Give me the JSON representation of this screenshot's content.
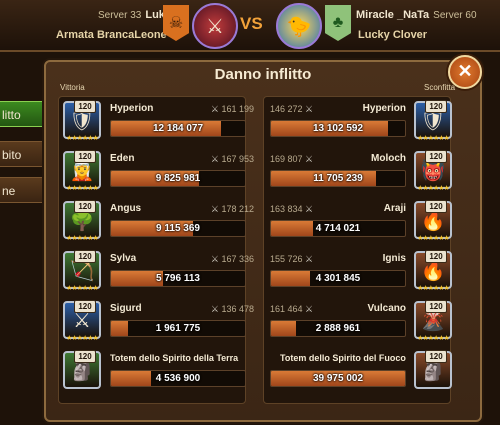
{
  "header": {
    "left": {
      "server": "Server 33",
      "name": "Luk",
      "guild": "Armata BrancaLeone",
      "banner_color": "#d9701f",
      "banner_emblem": "skull-icon"
    },
    "vs": "VS",
    "right": {
      "server": "Server 60",
      "name": "Miracle _NaTa",
      "guild": "Lucky Clover",
      "banner_color": "#8fc27a",
      "banner_emblem": "clover-icon"
    }
  },
  "side_tabs": [
    {
      "label": "Danno inflitto",
      "visible_text": "litto",
      "active": true
    },
    {
      "label": "",
      "visible_text": "bito",
      "active": false
    },
    {
      "label": "",
      "visible_text": "ne",
      "active": false
    }
  ],
  "panel": {
    "title": "Danno inflitto",
    "left_result": "Vittoria",
    "right_result": "Sconfitta"
  },
  "colors": {
    "accent": "#e07a2e",
    "bar_fill": "#c8652b",
    "active_tab": "#3c8a1f"
  },
  "left_heroes": [
    {
      "name": "Hyperion",
      "power": "161 199",
      "damage": "12 184 077",
      "level": "120",
      "stars": 6,
      "fill": 0.82,
      "icon": "hyperion-portrait",
      "frame": "#2c5fa8"
    },
    {
      "name": "Eden",
      "power": "167 953",
      "damage": "9 825 981",
      "level": "120",
      "stars": 6,
      "fill": 0.66,
      "icon": "eden-portrait",
      "frame": "#3f7a35"
    },
    {
      "name": "Angus",
      "power": "178 212",
      "damage": "9 115 369",
      "level": "120",
      "stars": 6,
      "fill": 0.61,
      "icon": "angus-portrait",
      "frame": "#3f7a35"
    },
    {
      "name": "Sylva",
      "power": "167 336",
      "damage": "5 796 113",
      "level": "120",
      "stars": 6,
      "fill": 0.39,
      "icon": "sylva-portrait",
      "frame": "#3f7a35"
    },
    {
      "name": "Sigurd",
      "power": "136 478",
      "damage": "1 961 775",
      "level": "120",
      "stars": 6,
      "fill": 0.13,
      "icon": "sigurd-portrait",
      "frame": "#2c5fa8"
    }
  ],
  "left_totem": {
    "name": "Totem dello Spirito della Terra",
    "damage": "4 536 900",
    "level": "120",
    "fill": 0.3,
    "icon": "earth-totem-portrait",
    "frame": "#3f7a35"
  },
  "right_heroes": [
    {
      "name": "Hyperion",
      "power": "146 272",
      "damage": "13 102 592",
      "level": "120",
      "stars": 6,
      "fill": 0.87,
      "icon": "hyperion-portrait",
      "frame": "#2c5fa8"
    },
    {
      "name": "Moloch",
      "power": "169 807",
      "damage": "11 705 239",
      "level": "120",
      "stars": 6,
      "fill": 0.78,
      "icon": "moloch-portrait",
      "frame": "#8a4b2a"
    },
    {
      "name": "Araji",
      "power": "163 834",
      "damage": "4 714 021",
      "level": "120",
      "stars": 6,
      "fill": 0.31,
      "icon": "araji-portrait",
      "frame": "#8a4b2a"
    },
    {
      "name": "Ignis",
      "power": "155 726",
      "damage": "4 301 845",
      "level": "120",
      "stars": 6,
      "fill": 0.29,
      "icon": "ignis-portrait",
      "frame": "#8a4b2a"
    },
    {
      "name": "Vulcano",
      "power": "161 464",
      "damage": "2 888 961",
      "level": "120",
      "stars": 6,
      "fill": 0.19,
      "icon": "vulcano-portrait",
      "frame": "#8a4b2a"
    }
  ],
  "right_totem": {
    "name": "Totem dello Spirito del Fuoco",
    "damage": "39 975 002",
    "level": "120",
    "fill": 1.0,
    "icon": "fire-totem-portrait",
    "frame": "#8a4b2a"
  }
}
